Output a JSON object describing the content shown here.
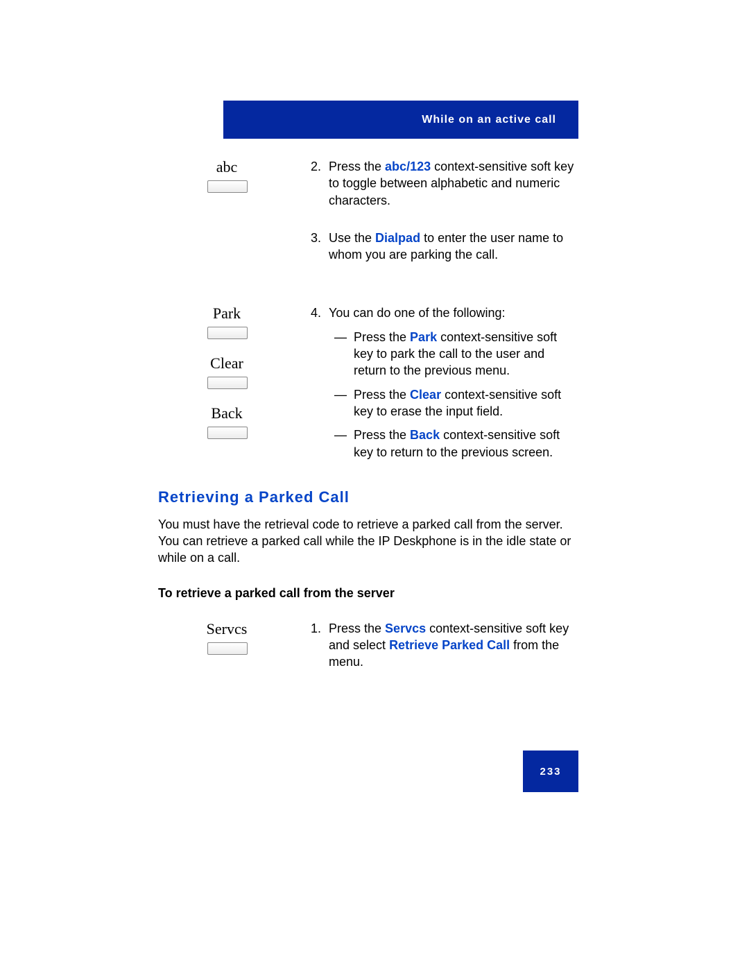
{
  "header": {
    "title": "While on an active call"
  },
  "softkeys": {
    "abc": "abc",
    "park": "Park",
    "clear": "Clear",
    "back": "Back",
    "servcs": "Servcs"
  },
  "steps": {
    "s2": {
      "num": "2.",
      "pre": "Press the ",
      "kw": "abc/123",
      "post": " context-sensitive soft key to toggle between alphabetic and numeric characters."
    },
    "s3": {
      "num": "3.",
      "pre": "Use the ",
      "kw": "Dialpad",
      "post": " to enter the user name to whom you are parking the call."
    },
    "s4": {
      "num": "4.",
      "lead": "You can do one of the following:",
      "a": {
        "pre": "Press the ",
        "kw": "Park",
        "post": " context-sensitive soft key to park the call to the user and return to the previous menu."
      },
      "b": {
        "pre": "Press the ",
        "kw": "Clear",
        "post": " context-sensitive soft key to erase the input field."
      },
      "c": {
        "pre": "Press the ",
        "kw": "Back",
        "post": " context-sensitive soft key to return to the previous screen."
      }
    }
  },
  "section": {
    "heading": "Retrieving a Parked Call",
    "para": "You must have the retrieval code to retrieve a parked call from the server. You can retrieve a parked call while the IP Deskphone is in the idle state or while on a call.",
    "subheading": "To retrieve a parked call from the server",
    "step1": {
      "num": "1.",
      "pre": "Press the ",
      "kw1": "Servcs",
      "mid": " context-sensitive soft key and select ",
      "kw2": "Retrieve Parked Call",
      "post": " from the menu."
    }
  },
  "dash": "—",
  "page_number": "233"
}
